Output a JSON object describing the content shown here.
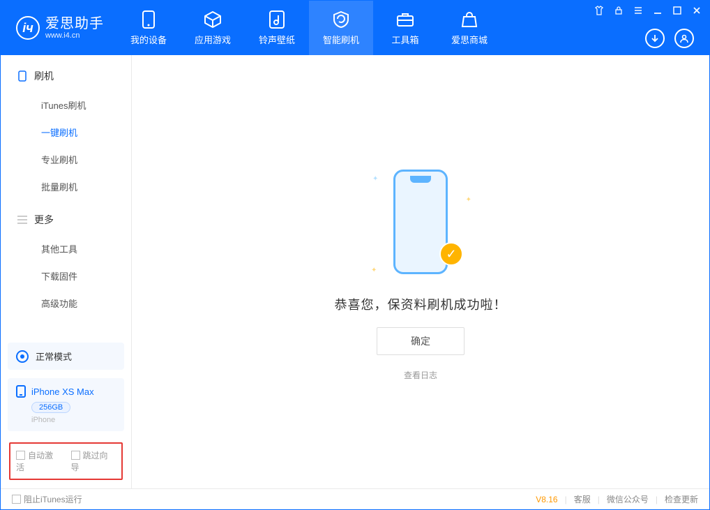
{
  "app": {
    "name_cn": "爱思助手",
    "name_en": "www.i4.cn"
  },
  "tabs": {
    "device": "我的设备",
    "apps": "应用游戏",
    "ringtones": "铃声壁纸",
    "flash": "智能刷机",
    "toolbox": "工具箱",
    "store": "爱思商城"
  },
  "sidebar": {
    "section_flash": "刷机",
    "items_flash": {
      "itunes": "iTunes刷机",
      "onekey": "一键刷机",
      "pro": "专业刷机",
      "batch": "批量刷机"
    },
    "section_more": "更多",
    "items_more": {
      "other": "其他工具",
      "firmware": "下载固件",
      "advanced": "高级功能"
    }
  },
  "mode": {
    "label": "正常模式"
  },
  "device": {
    "name": "iPhone XS Max",
    "capacity": "256GB",
    "type": "iPhone"
  },
  "checkboxes": {
    "auto_activate": "自动激活",
    "skip_guide": "跳过向导"
  },
  "main": {
    "success_text": "恭喜您，保资料刷机成功啦！",
    "ok_button": "确定",
    "view_log": "查看日志"
  },
  "statusbar": {
    "block_itunes": "阻止iTunes运行",
    "version": "V8.16",
    "support": "客服",
    "wechat": "微信公众号",
    "update": "检查更新"
  }
}
